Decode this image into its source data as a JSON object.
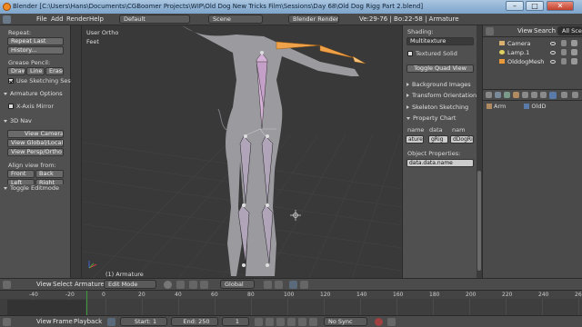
{
  "titlebar": {
    "title": "Blender [C:\\Users\\Hans\\Documents\\CGBoomer Projects\\WIP\\Old Dog New Tricks Film\\Sessions\\Day 68\\Old Dog Rigg Part 2.blend]",
    "min": "–",
    "max": "□",
    "close": "✕"
  },
  "infobar": {
    "menus": [
      "File",
      "Add",
      "Render",
      "Help"
    ],
    "screen": "Default",
    "scene": "Scene",
    "engine": "Blender Render",
    "stats": "Ve:29-76 | Bo:22-58 | Armature"
  },
  "toolshelf": {
    "repeat_header": "Repeat:",
    "repeat_last": "Repeat Last",
    "history": "History...",
    "grease_header": "Grease Pencil:",
    "draw": "Draw",
    "line": "Line",
    "erase": "Erase",
    "use_sketching": "Use Sketching Sessio",
    "armature_options": "Armature Options",
    "x_axis_mirror": "X-Axis Mirror",
    "nav3d": "3D Nav",
    "view_camera": "View Camera",
    "view_global_local": "View Global/Local",
    "view_persp_ortho": "View Persp/Ortho",
    "align_view_from": "Align view from:",
    "front": "Front",
    "back": "Back",
    "left": "Left",
    "right": "Right",
    "toggle_editmode": "Toggle Editmode"
  },
  "viewport": {
    "view_label": "User Ortho",
    "units_label": "Feet",
    "object_label": "(1) Armature"
  },
  "properties_shelf": {
    "shading_header": "Shading:",
    "shading_mode": "Multitexture",
    "textured_solid": "Textured Solid",
    "toggle_quad_view": "Toggle Quad View",
    "background_images": "Background Images",
    "transform_orientations": "Transform Orientations",
    "skeleton_sketching": "Skeleton Sketching",
    "property_chart": "Property Chart",
    "chart_cols": [
      "name",
      "data",
      "nam"
    ],
    "chart_vals": [
      "ature",
      "gRig",
      "dDogRig"
    ],
    "object_properties": "Object Properties:",
    "object_prop_value": "data.data.name"
  },
  "outliner": {
    "menus": [
      "View",
      "Search"
    ],
    "filter": "All Scene",
    "items": [
      "Camera",
      "Lamp.1",
      "OlddogMesh"
    ]
  },
  "properties_editor": {
    "breadcrumb_a": "Arm",
    "breadcrumb_b": "OldD"
  },
  "view3d_header": {
    "menus": [
      "View",
      "Select",
      "Armature"
    ],
    "mode": "Edit Mode",
    "orientation": "Global"
  },
  "timeline": {
    "ticks": [
      "-40",
      "-20",
      "0",
      "20",
      "40",
      "60",
      "80",
      "100",
      "120",
      "140",
      "160",
      "180",
      "200",
      "220",
      "240",
      "260"
    ],
    "current_frame": 1
  },
  "timeline_header": {
    "menus": [
      "View",
      "Frame",
      "Playback"
    ],
    "start": "Start: 1",
    "end": "End: 250",
    "current": "1",
    "sync": "No Sync"
  },
  "colors": {
    "selected_bone": "#f0a24a",
    "playhead": "#3c9c3c",
    "panel": "#505050",
    "viewport_bg": "#393939"
  }
}
